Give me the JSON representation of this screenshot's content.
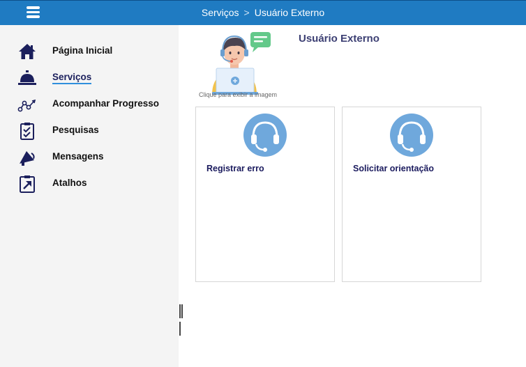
{
  "header": {
    "menu_icon": "hamburger-icon",
    "breadcrumb": [
      "Serviços",
      "Usuário Externo"
    ],
    "separator": ">"
  },
  "sidebar": {
    "items": [
      {
        "label": "Página Inicial",
        "icon": "home-icon",
        "active": false
      },
      {
        "label": "Serviços",
        "icon": "service-bell-icon",
        "active": true
      },
      {
        "label": "Acompanhar Progresso",
        "icon": "progress-graph-icon",
        "active": false
      },
      {
        "label": "Pesquisas",
        "icon": "clipboard-checklist-icon",
        "active": false
      },
      {
        "label": "Mensagens",
        "icon": "megaphone-icon",
        "active": false
      },
      {
        "label": "Atalhos",
        "icon": "shortcut-arrow-icon",
        "active": false
      }
    ]
  },
  "main": {
    "title": "Usuário Externo",
    "hero_caption": "Clique para exibir a imagem",
    "cards": [
      {
        "label": "Registrar erro",
        "icon": "headset-icon"
      },
      {
        "label": "Solicitar orientação",
        "icon": "headset-icon"
      }
    ]
  },
  "colors": {
    "topbar": "#1f7bc2",
    "sidebar_bg": "#f4f4f4",
    "nav_icon": "#1b1f5c",
    "active_underline": "#2f8fdc",
    "card_icon": "#6fa8dc"
  }
}
